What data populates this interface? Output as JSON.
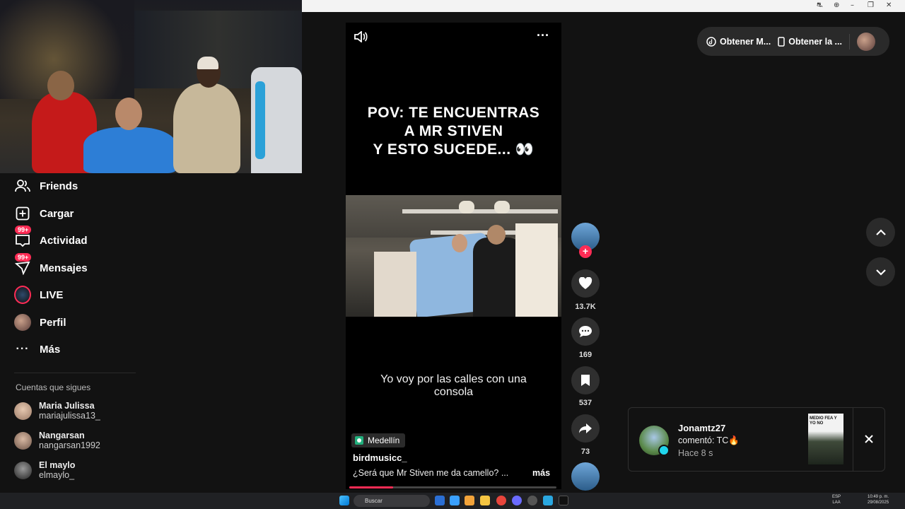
{
  "browser": {
    "controls": [
      "⛐",
      "⊕",
      "–",
      "❐",
      "✕"
    ]
  },
  "sidebar": {
    "items": [
      {
        "label": "Friends",
        "icon": "friends-icon"
      },
      {
        "label": "Cargar",
        "icon": "upload-icon"
      },
      {
        "label": "Actividad",
        "icon": "activity-icon",
        "badge": "99+"
      },
      {
        "label": "Mensajes",
        "icon": "messages-icon",
        "badge": "99+"
      },
      {
        "label": "LIVE",
        "icon": "live-icon"
      },
      {
        "label": "Perfil",
        "icon": "profile-avatar"
      },
      {
        "label": "Más",
        "icon": "more-icon"
      }
    ],
    "following_title": "Cuentas que sigues",
    "following": [
      {
        "name": "Maria Julissa",
        "handle": "mariajulissa13_"
      },
      {
        "name": "Nangarsan",
        "handle": "nangarsan1992"
      },
      {
        "name": "El maylo",
        "handle": "elmaylo_"
      }
    ]
  },
  "video": {
    "pov_line1": "POV: TE ENCUENTRAS",
    "pov_line2": "A MR STIVEN",
    "pov_line3": "Y ESTO SUCEDE... 👀",
    "subtitle_line1": "Yo voy por las calles con una",
    "subtitle_line2": "consola",
    "location": "Medellín",
    "author": "birdmusicc_",
    "description": "¿Será que Mr Stiven me da camello? ...",
    "more_label": "más",
    "progress": 0.21
  },
  "actions": {
    "likes": "13.7K",
    "comments": "169",
    "saves": "537",
    "shares": "73"
  },
  "top_pill": {
    "get_app_label": "Obtener M...",
    "get_device_label": "Obtener la ..."
  },
  "notification": {
    "user": "Jonamtz27",
    "text": "comentó: TC🔥",
    "time": "Hace 8 s",
    "thumb_text": "MEDIO FEA Y YO NO"
  },
  "taskbar": {
    "search_placeholder": "Buscar",
    "lang": "ESP",
    "lang2": "LAA",
    "time": "10:49 p. m.",
    "date": "29/08/2025"
  },
  "colors": {
    "accent": "#fe2c55",
    "background": "#121212",
    "surface": "#2a2a2a"
  }
}
